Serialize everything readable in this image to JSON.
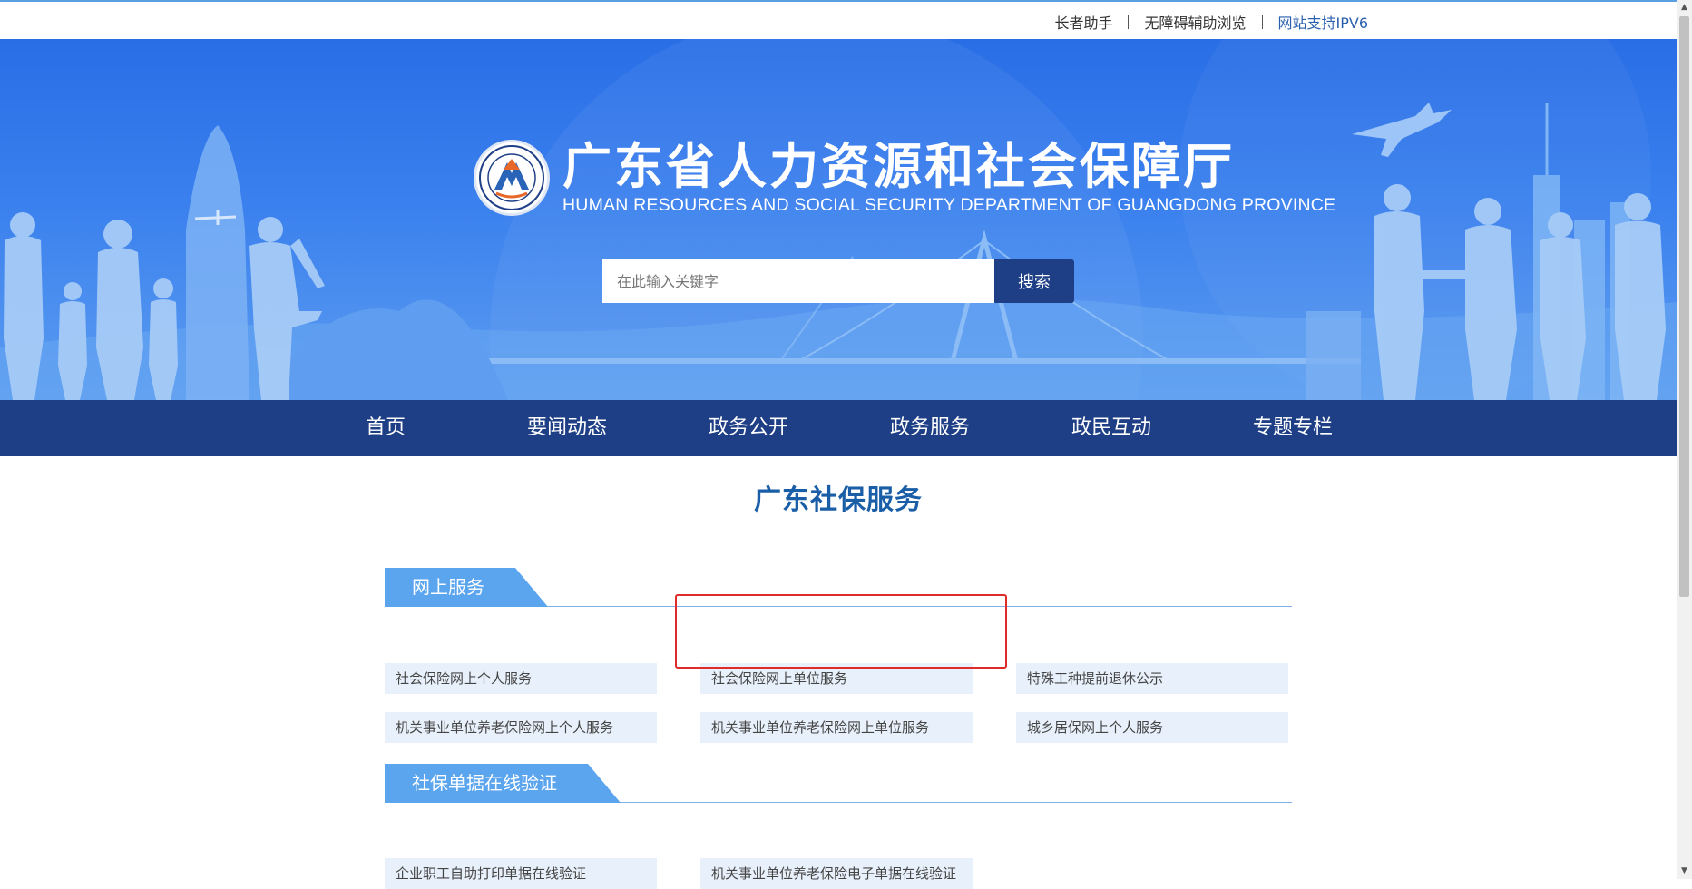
{
  "top_links": {
    "elder": "长者助手",
    "accessible": "无障碍辅助浏览",
    "ipv6": "网站支持IPV6"
  },
  "header": {
    "title_cn": "广东省人力资源和社会保障厅",
    "title_en": "HUMAN RESOURCES AND SOCIAL SECURITY DEPARTMENT OF GUANGDONG PROVINCE",
    "emblem_icon": "department-emblem-icon"
  },
  "search": {
    "placeholder": "在此输入关键字",
    "value": "",
    "button_label": "搜索"
  },
  "nav": {
    "items": [
      {
        "label": "首页"
      },
      {
        "label": "要闻动态"
      },
      {
        "label": "政务公开"
      },
      {
        "label": "政务服务"
      },
      {
        "label": "政民互动"
      },
      {
        "label": "专题专栏"
      }
    ]
  },
  "main": {
    "title": "广东社保服务",
    "sections": [
      {
        "title": "网上服务",
        "items": [
          {
            "label": "社会保险网上个人服务"
          },
          {
            "label": "社会保险网上单位服务"
          },
          {
            "label": "特殊工种提前退休公示"
          },
          {
            "label": "机关事业单位养老保险网上个人服务"
          },
          {
            "label": "机关事业单位养老保险网上单位服务"
          },
          {
            "label": "城乡居保网上个人服务"
          }
        ]
      },
      {
        "title": "社保单据在线验证",
        "items": [
          {
            "label": "企业职工自助打印单据在线验证"
          },
          {
            "label": "机关事业单位养老保险电子单据在线验证"
          }
        ]
      }
    ]
  },
  "colors": {
    "nav_bg": "#1e3f86",
    "banner_blue": "#3a80ee",
    "title_blue": "#1a5ea8",
    "tab_blue": "#5ba4ee",
    "card_bg": "#e8f1fb",
    "highlight_red": "#e02b2b"
  }
}
